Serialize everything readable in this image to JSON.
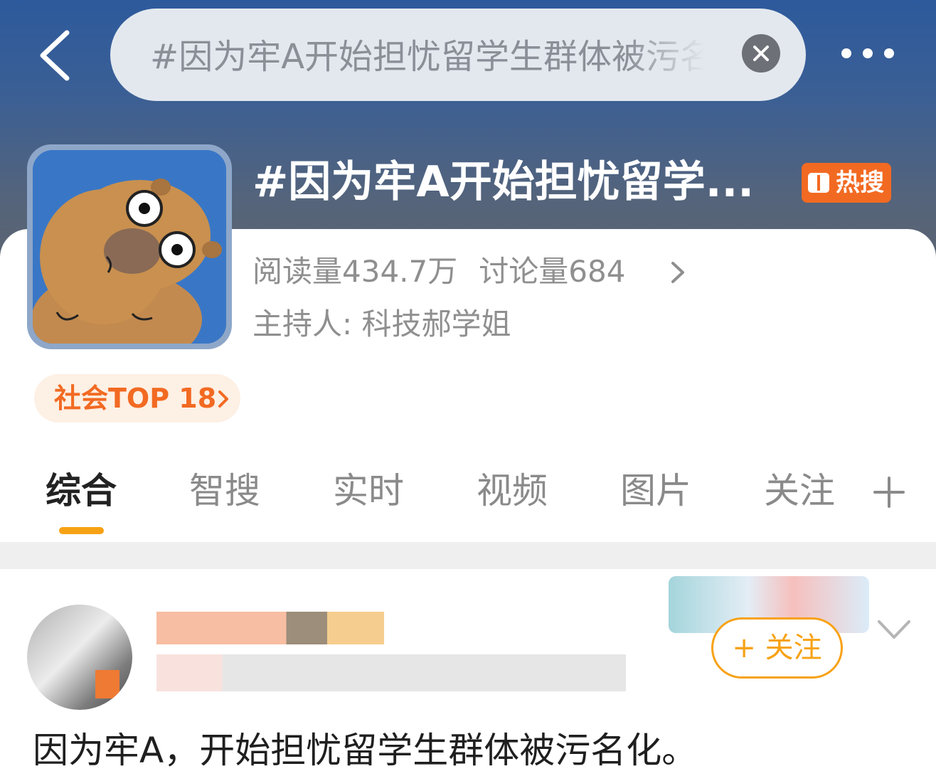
{
  "header": {
    "search_query": "#因为牢A开始担忧留学生群体被污名化#",
    "back_icon": "chevron-left-icon",
    "clear_icon": "close-icon",
    "more_icon": "more-horizontal-icon"
  },
  "topic": {
    "title": "#因为牢A开始担忧留学...",
    "hot_badge": "热搜",
    "reads_label": "阅读量434.7万",
    "discussion_label": "讨论量684",
    "host_label": "主持人:",
    "host_name": "科技郝学姐",
    "rank_label": "社会TOP 18"
  },
  "tabs": [
    {
      "label": "综合",
      "active": true
    },
    {
      "label": "智搜",
      "active": false
    },
    {
      "label": "实时",
      "active": false
    },
    {
      "label": "视频",
      "active": false
    },
    {
      "label": "图片",
      "active": false
    },
    {
      "label": "关注",
      "active": false
    }
  ],
  "post": {
    "follow_label": "+ 关注",
    "body": "因为牢A，开始担忧留学生群体被污名化。"
  },
  "colors": {
    "accent_orange": "#f26a22",
    "tab_underline": "#f7a215",
    "header_blue": "#2d5a9c"
  }
}
